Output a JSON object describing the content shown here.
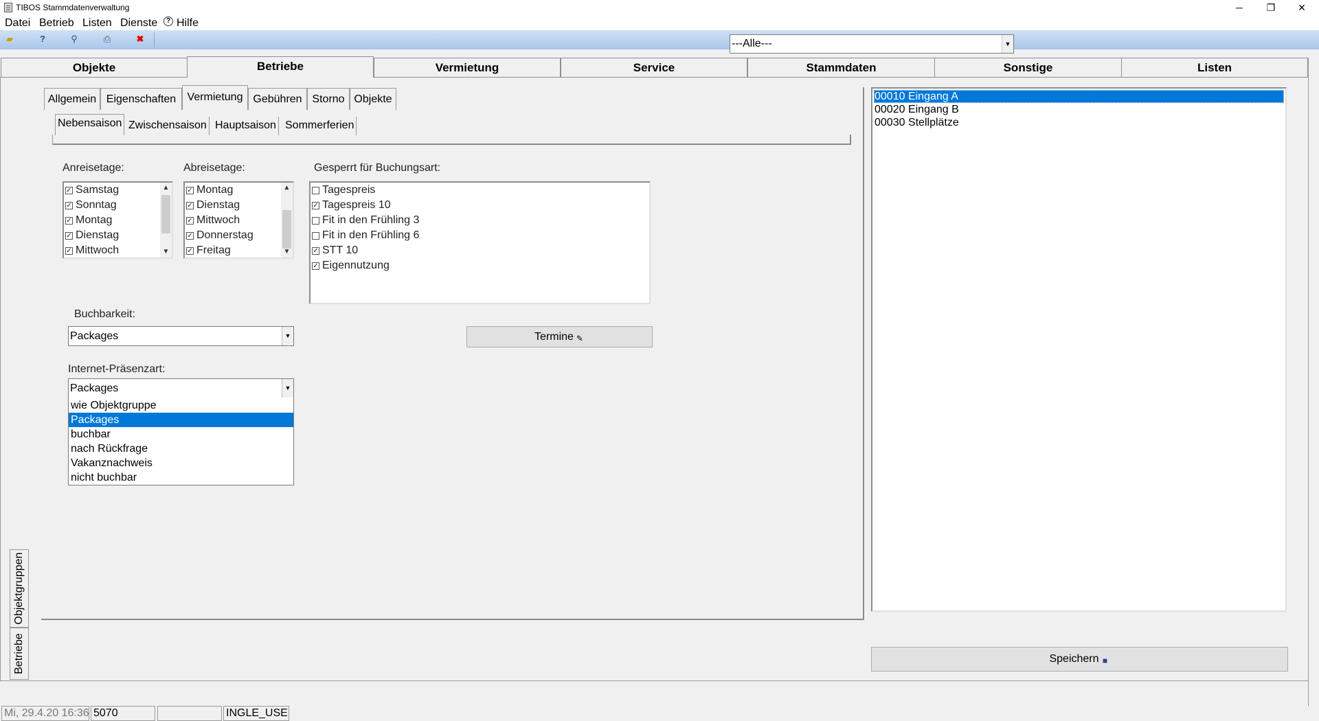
{
  "window": {
    "title": "TIBOS Stammdatenverwaltung",
    "controls": {
      "minimize": "─",
      "restore": "❐",
      "close": "✕"
    }
  },
  "menu": {
    "items": [
      "Datei",
      "Betrieb",
      "Listen",
      "Dienste",
      "Hilfe"
    ]
  },
  "toolbar": {
    "icons": [
      "open-folder-icon",
      "help-icon",
      "search-icon",
      "print-icon",
      "delete-icon"
    ],
    "filter_value": "---Alle---"
  },
  "main_tabs": [
    "Objekte",
    "Betriebe",
    "Vermietung",
    "Service",
    "Stammdaten",
    "Sonstige",
    "Listen"
  ],
  "active_main_tab": "Betriebe",
  "side_tabs": [
    "Objektgruppen",
    "Betriebe"
  ],
  "sub_tabs": [
    "Allgemein",
    "Eigenschaften",
    "Vermietung",
    "Gebühren",
    "Storno",
    "Objekte"
  ],
  "active_sub_tab": "Vermietung",
  "season_tabs": [
    "Nebensaison",
    "Zwischensaison",
    "Hauptsaison",
    "Sommerferien"
  ],
  "active_season_tab": "Nebensaison",
  "anreise": {
    "label": "Anreisetage:",
    "items": [
      {
        "label": "Samstag",
        "checked": true
      },
      {
        "label": "Sonntag",
        "checked": true
      },
      {
        "label": "Montag",
        "checked": true
      },
      {
        "label": "Dienstag",
        "checked": true
      },
      {
        "label": "Mittwoch",
        "checked": true
      }
    ]
  },
  "abreise": {
    "label": "Abreisetage:",
    "items": [
      {
        "label": "Montag",
        "checked": true
      },
      {
        "label": "Dienstag",
        "checked": true
      },
      {
        "label": "Mittwoch",
        "checked": true
      },
      {
        "label": "Donnerstag",
        "checked": true
      },
      {
        "label": "Freitag",
        "checked": true
      }
    ]
  },
  "gesperrt": {
    "label": "Gesperrt für Buchungsart:",
    "items": [
      {
        "label": "Tagespreis",
        "checked": false
      },
      {
        "label": "Tagespreis 10",
        "checked": true
      },
      {
        "label": "Fit in den Frühling 3",
        "checked": false
      },
      {
        "label": "Fit in den Frühling 6",
        "checked": false
      },
      {
        "label": "STT 10",
        "checked": true
      },
      {
        "label": "Eigennutzung",
        "checked": true
      }
    ]
  },
  "buchbarkeit": {
    "label": "Buchbarkeit:",
    "value": "Packages"
  },
  "termine_button": "Termine",
  "internet": {
    "label": "Internet-Präsenzart:",
    "value": "Packages",
    "options": [
      "wie Objektgruppe",
      "Packages",
      "buchbar",
      "nach Rückfrage",
      "Vakanznachweis",
      "nicht buchbar"
    ],
    "selected": "Packages"
  },
  "right_list": {
    "items": [
      "00010 Eingang A",
      "00020 Eingang B",
      "00030 Stellplätze"
    ],
    "selected": "00010 Eingang A"
  },
  "save_button": "Speichern",
  "status": {
    "datetime": "Mi, 29.4.20 16:36",
    "number": "5070",
    "empty": "",
    "user": "INGLE_USE"
  },
  "colors": {
    "selection": "#0078d7",
    "toolbar_top": "#cfe0f5",
    "toolbar_bottom": "#a9c6ea",
    "background": "#f0f0f0"
  }
}
